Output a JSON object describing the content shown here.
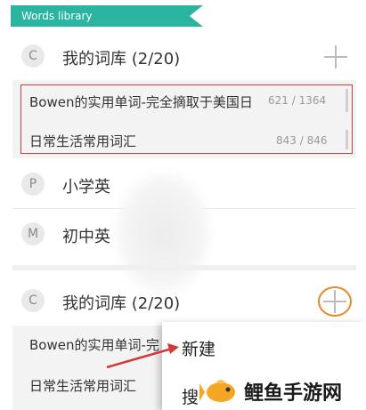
{
  "banner": {
    "label": "Words library"
  },
  "section_top": {
    "letter": "C",
    "title": "我的词库 (2/20)",
    "items": [
      {
        "name": "Bowen的实用单词-完全摘取于美国日",
        "count": "621 / 1364"
      },
      {
        "name": "日常生活常用词汇",
        "count": "843 / 846"
      }
    ]
  },
  "groups": [
    {
      "letter": "P",
      "title": "小学英"
    },
    {
      "letter": "M",
      "title": "初中英"
    }
  ],
  "section_bottom": {
    "letter": "C",
    "title": "我的词库 (2/20)",
    "items": [
      {
        "name": "Bowen的实用单词-完"
      },
      {
        "name": "日常生活常用词汇"
      }
    ]
  },
  "popup_menu": {
    "items": [
      "新建",
      "搜"
    ]
  },
  "watermark": {
    "text": "鲤鱼手游网"
  },
  "colors": {
    "banner": "#2bb5a0",
    "highlight_frame": "#d23a3a",
    "orange_ring": "#e5892a",
    "arrow": "#d23a3a"
  }
}
